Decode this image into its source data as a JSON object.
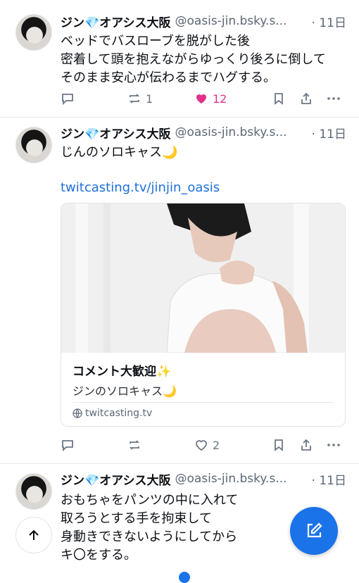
{
  "posts": [
    {
      "author": "ジン💎オアシス大阪",
      "handle": "@oasis-jin.bsky.s...",
      "time": "· 11日",
      "text": "ベッドでバスローブを脱がした後\n密着して頭を抱えながらゆっくり後ろに倒して\nそのまま安心が伝わるまでハグする。",
      "reply_count": "",
      "repost_count": "1",
      "like_count": "12"
    },
    {
      "author": "ジン💎オアシス大阪",
      "handle": "@oasis-jin.bsky.s...",
      "time": "· 11日",
      "text": "じんのソロキャス🌙",
      "link": "twitcasting.tv/jinjin_oasis",
      "card": {
        "title": "コメント大歓迎✨",
        "description": "ジンのソロキャス🌙",
        "domain": "twitcasting.tv"
      },
      "reply_count": "",
      "repost_count": "",
      "like_count": "2"
    },
    {
      "author": "ジン💎オアシス大阪",
      "handle": "@oasis-jin.bsky.s...",
      "time": "· 11日",
      "text": "おもちゃをパンツの中に入れて\n取ろうとする手を拘束して\n身動きできないようにしてから\nキ〇をする。"
    }
  ],
  "colors": {
    "accent": "#1a73e8",
    "like": "#e0328b",
    "link": "#1f6fd9",
    "muted": "#6b7785"
  }
}
